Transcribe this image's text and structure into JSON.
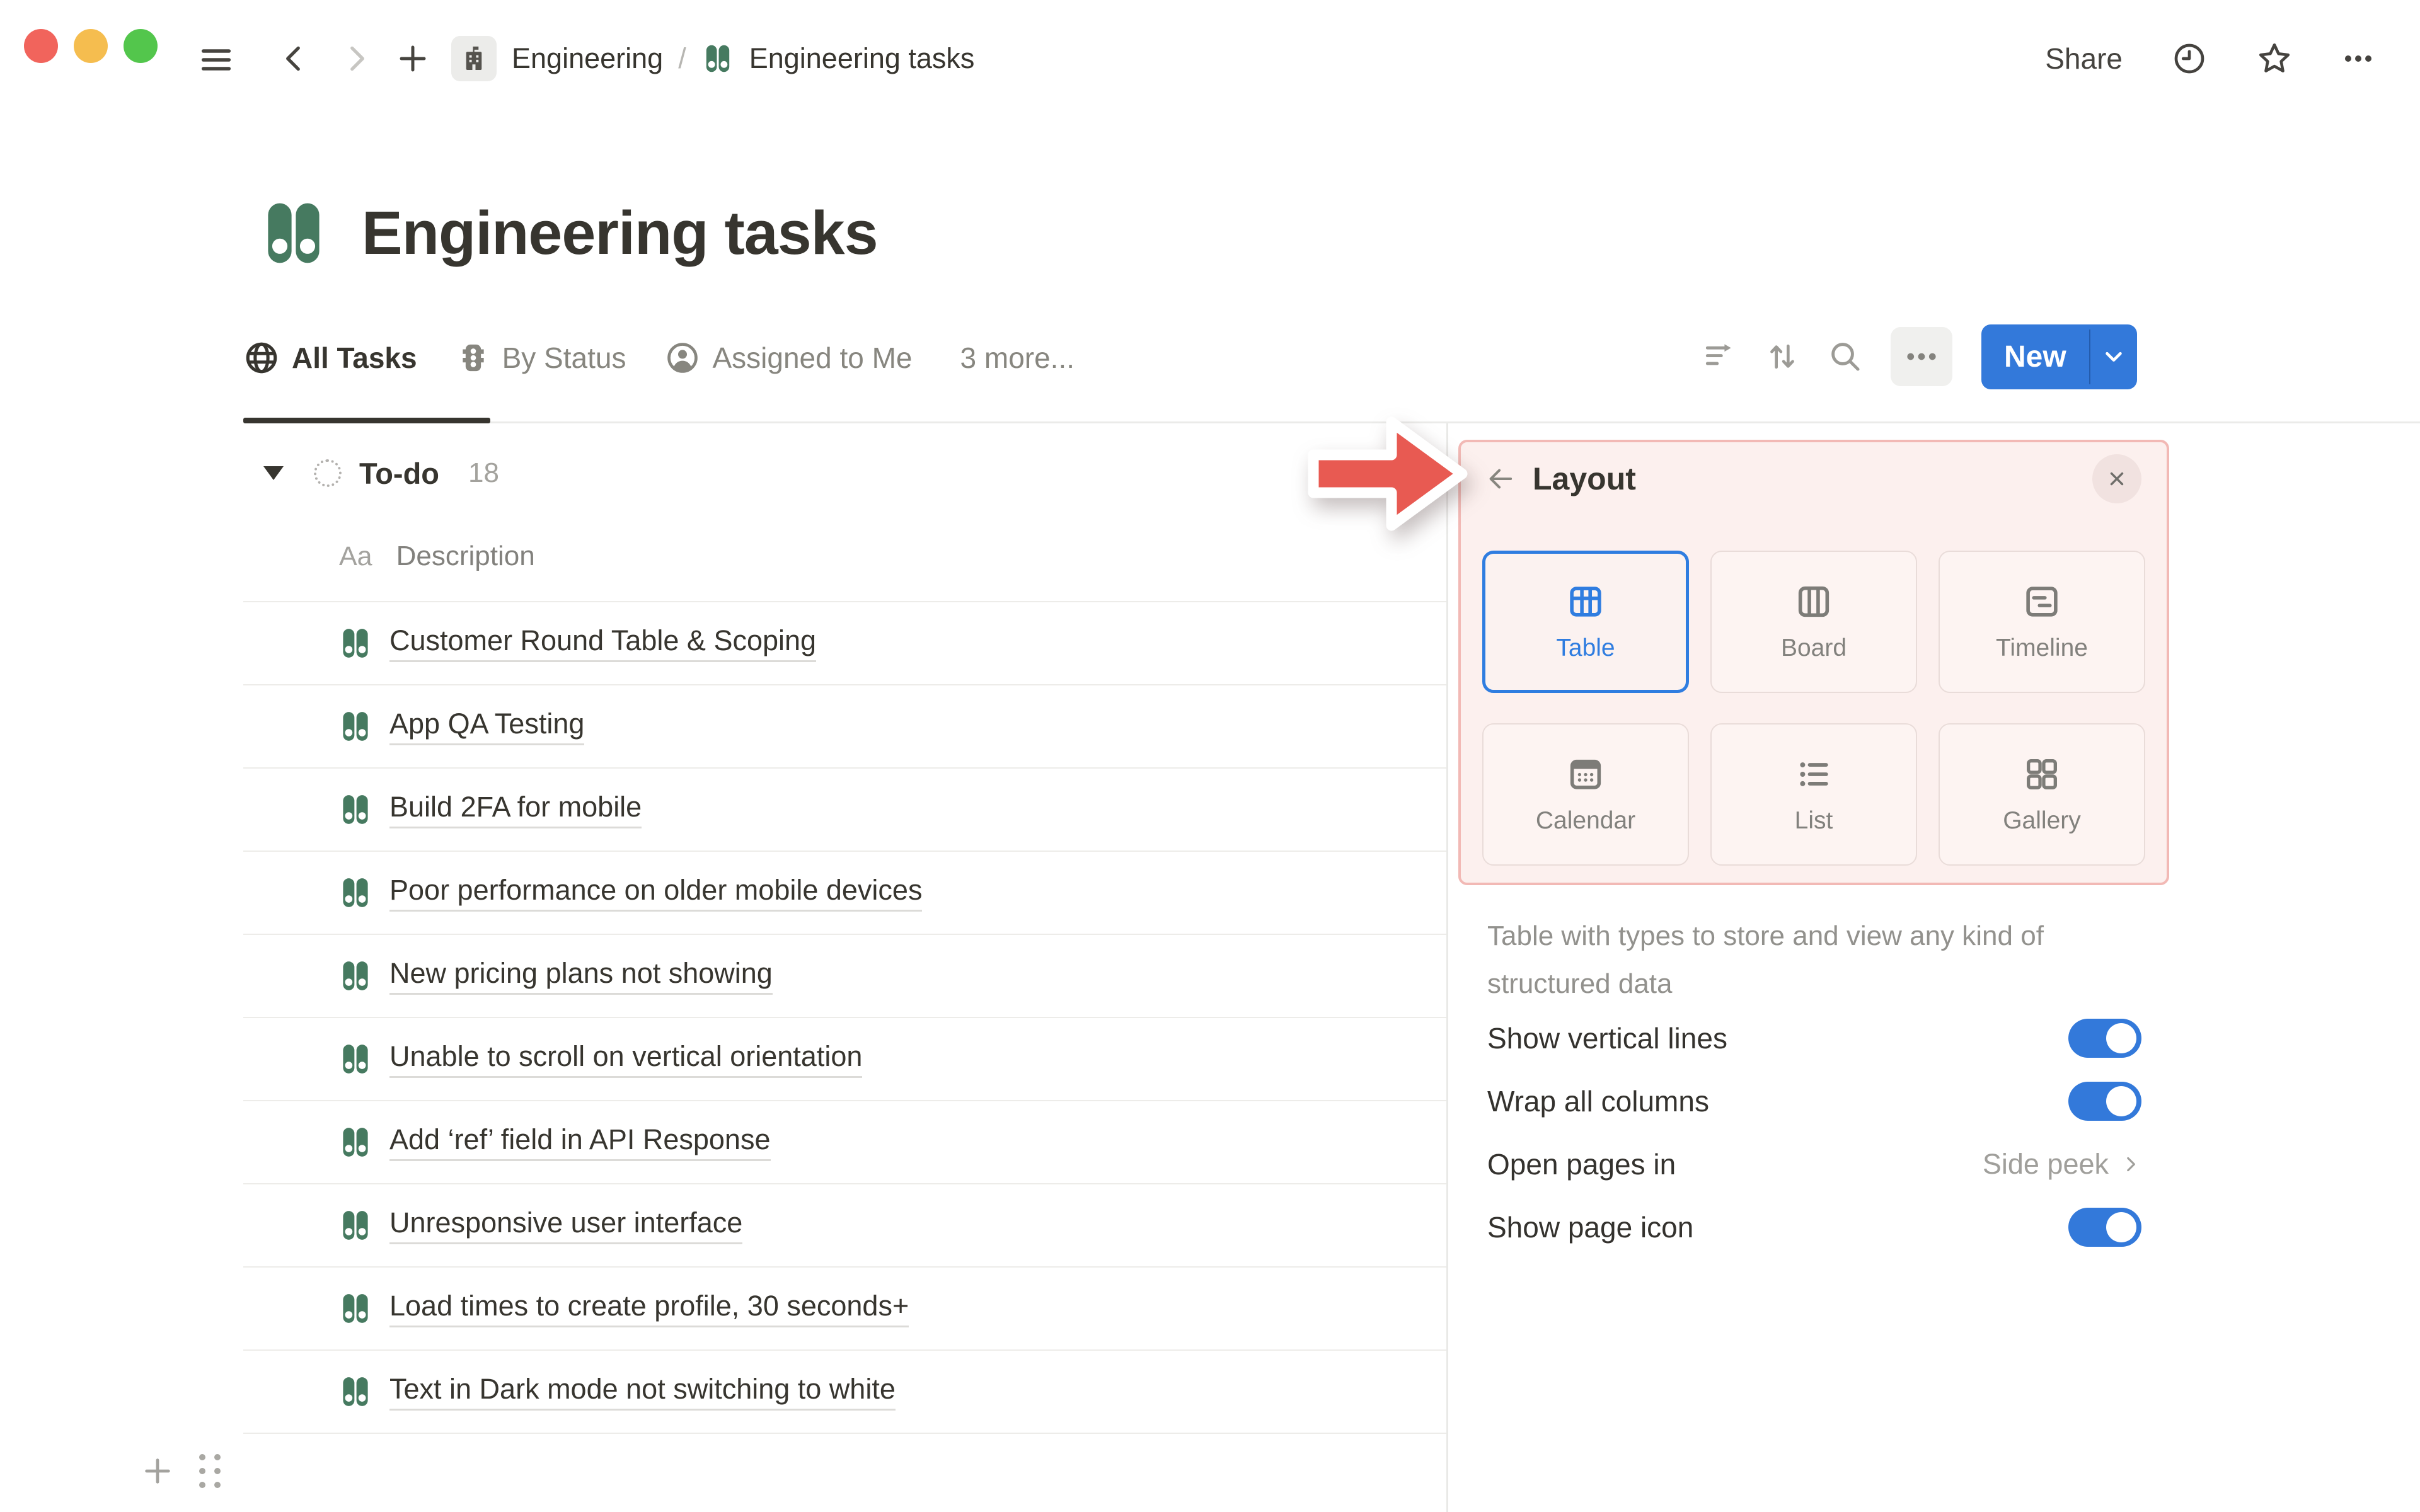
{
  "topbar": {
    "breadcrumb": {
      "teamspace": "Engineering",
      "separator": "/",
      "page": "Engineering tasks"
    },
    "share_label": "Share"
  },
  "page": {
    "title": "Engineering tasks"
  },
  "views": {
    "tabs": [
      {
        "label": "All Tasks"
      },
      {
        "label": "By Status"
      },
      {
        "label": "Assigned to Me"
      },
      {
        "label": "3 more..."
      }
    ]
  },
  "toolbar": {
    "new_label": "New"
  },
  "table": {
    "group": {
      "name": "To-do",
      "count": "18"
    },
    "columns": {
      "title_type": "Aa",
      "title_label": "Description"
    },
    "rows": [
      "Customer Round Table & Scoping",
      "App QA Testing",
      "Build 2FA for mobile",
      "Poor performance on older mobile devices",
      "New pricing plans not showing",
      "Unable to scroll on vertical orientation",
      "Add ‘ref’ field in API Response",
      "Unresponsive user interface",
      "Load times to create profile, 30 seconds+",
      "Text in Dark mode not switching to white"
    ]
  },
  "layout_panel": {
    "title": "Layout",
    "options": [
      {
        "label": "Table",
        "selected": true
      },
      {
        "label": "Board",
        "selected": false
      },
      {
        "label": "Timeline",
        "selected": false
      },
      {
        "label": "Calendar",
        "selected": false
      },
      {
        "label": "List",
        "selected": false
      },
      {
        "label": "Gallery",
        "selected": false
      }
    ],
    "description": "Table with types to store and view any kind of structured data",
    "settings": [
      {
        "label": "Show vertical lines",
        "type": "toggle",
        "on": true
      },
      {
        "label": "Wrap all columns",
        "type": "toggle",
        "on": true
      },
      {
        "label": "Open pages in",
        "type": "value",
        "value": "Side peek"
      },
      {
        "label": "Show page icon",
        "type": "toggle",
        "on": true
      }
    ]
  },
  "colors": {
    "accent_blue": "#2f7de0",
    "notion_green": "#467a60",
    "highlight_border": "#f2b9b5",
    "highlight_bg": "#fcf0ee",
    "annotation_red": "#e85a52",
    "text_dark": "#37352f",
    "text_gray": "#87867f"
  }
}
